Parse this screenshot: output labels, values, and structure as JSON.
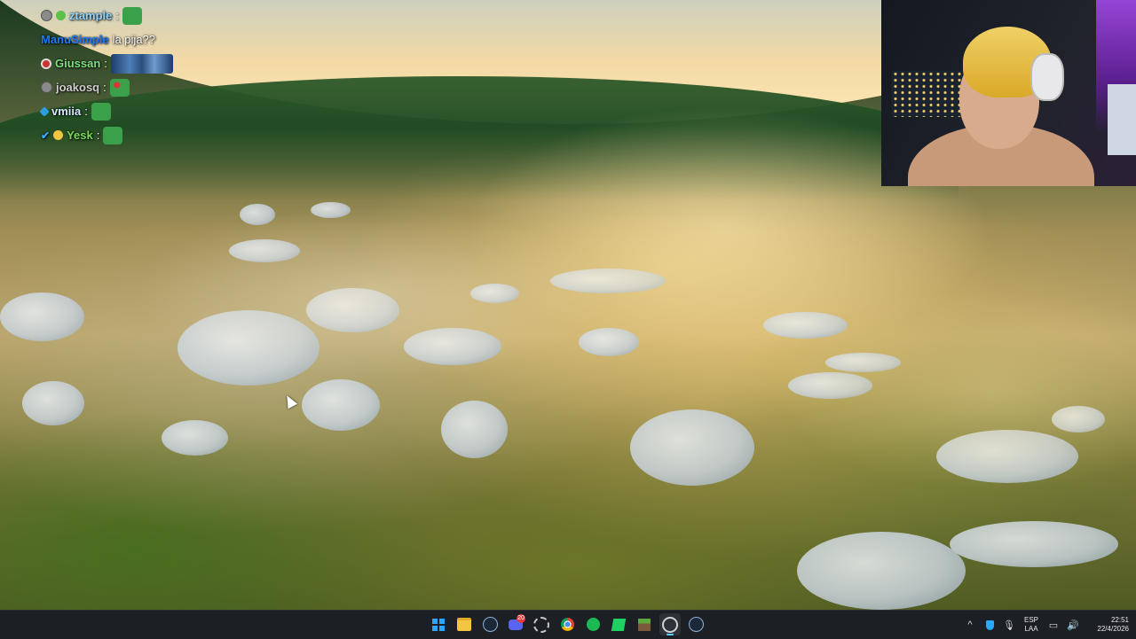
{
  "chat": {
    "messages": [
      {
        "badges": [
          "gray-badge",
          "green-face-badge"
        ],
        "user": "ztample",
        "separator": ":",
        "text": "",
        "emote": "frog-emote"
      },
      {
        "badges": [],
        "user": "ManuSimple",
        "separator": ":",
        "text": "la pija??",
        "emote": ""
      },
      {
        "badges": [
          "red-badge"
        ],
        "user": "Giussan",
        "separator": ":",
        "text": "",
        "emote": "wide-emote"
      },
      {
        "badges": [
          "gray-badge"
        ],
        "user": "joakosq",
        "separator": ":",
        "text": "",
        "emote": "frog-face-emote"
      },
      {
        "badges": [
          "blue-badge"
        ],
        "user": "vmiia",
        "separator": ":",
        "text": "",
        "emote": "frog-emote"
      },
      {
        "badges": [
          "check-badge",
          "smile-badge"
        ],
        "user": "Yesk",
        "separator": ":",
        "text": "",
        "emote": "frog-emote"
      }
    ],
    "colors": {
      "ztample": "#8fd5ff",
      "ManuSimple": "#1e7bff",
      "Giussan": "#7ee081",
      "joakosq": "#cfcfcf",
      "vmiia": "#d6e7ff",
      "Yesk": "#7bd85a"
    }
  },
  "taskbar": {
    "apps": [
      {
        "name": "start-button",
        "icon": "windows-icon"
      },
      {
        "name": "file-explorer-button",
        "icon": "folder-icon"
      },
      {
        "name": "steam-button",
        "icon": "steam-icon"
      },
      {
        "name": "discord-button",
        "icon": "discord-icon",
        "badge": "20"
      },
      {
        "name": "settings-button",
        "icon": "gear-icon"
      },
      {
        "name": "chrome-button",
        "icon": "chrome-icon"
      },
      {
        "name": "spotify-button",
        "icon": "spotify-icon"
      },
      {
        "name": "kick-button",
        "icon": "kick-icon"
      },
      {
        "name": "minecraft-button",
        "icon": "minecraft-icon"
      },
      {
        "name": "obs-button",
        "icon": "obs-icon",
        "active": true
      },
      {
        "name": "steam-2-button",
        "icon": "steam-icon"
      }
    ],
    "tray": {
      "chevron": "^",
      "language_top": "ESP",
      "language_bottom": "LAA",
      "time": "22:51",
      "date": "22/4/2026"
    }
  }
}
